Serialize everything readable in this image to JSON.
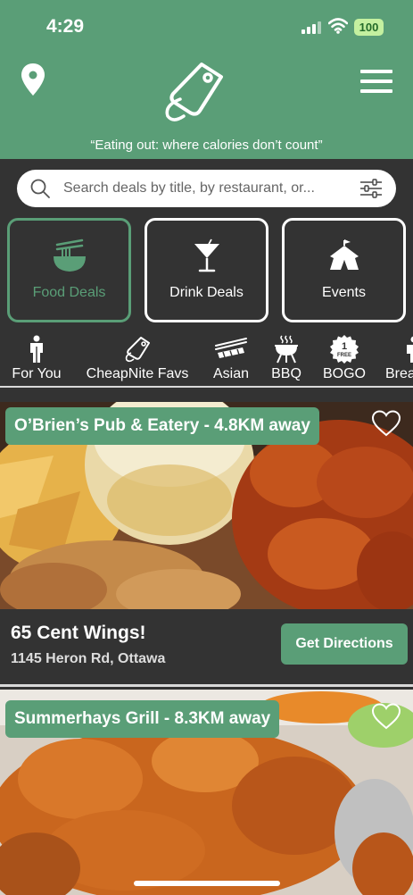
{
  "status": {
    "time": "4:29",
    "battery": "100"
  },
  "header": {
    "location_icon": "map-pin-icon",
    "logo_icon": "price-tag-icon",
    "menu_icon": "hamburger-menu-icon",
    "tagline": "“Eating out: where calories don’t count”"
  },
  "search": {
    "placeholder": "Search deals by title, by restaurant, or..."
  },
  "categories": [
    {
      "label": "Food Deals",
      "icon": "noodle-bowl-icon",
      "active": true
    },
    {
      "label": "Drink Deals",
      "icon": "cocktail-icon",
      "active": false
    },
    {
      "label": "Events",
      "icon": "circus-tent-icon",
      "active": false
    }
  ],
  "filters": [
    {
      "label": "For You",
      "icon": "person-icon"
    },
    {
      "label": "CheapNite Favs",
      "icon": "tag-icon"
    },
    {
      "label": "Asian",
      "icon": "sushi-chopsticks-icon"
    },
    {
      "label": "BBQ",
      "icon": "grill-icon"
    },
    {
      "label": "BOGO",
      "icon": "bogo-badge-icon",
      "badge_top": "1",
      "badge_bottom": "FREE"
    },
    {
      "label": "Brea",
      "icon": "breakfast-icon"
    }
  ],
  "deals": [
    {
      "restaurant_label": "O’Brien’s Pub & Eatery - 4.8KM away",
      "title": "65 Cent Wings!",
      "address": "1145 Heron Rd, Ottawa",
      "button": "Get Directions",
      "favorited": false
    },
    {
      "restaurant_label": "Summerhays Grill - 8.3KM away",
      "favorited": false
    }
  ],
  "colors": {
    "brand": "#5a9e77",
    "background": "#333333"
  }
}
